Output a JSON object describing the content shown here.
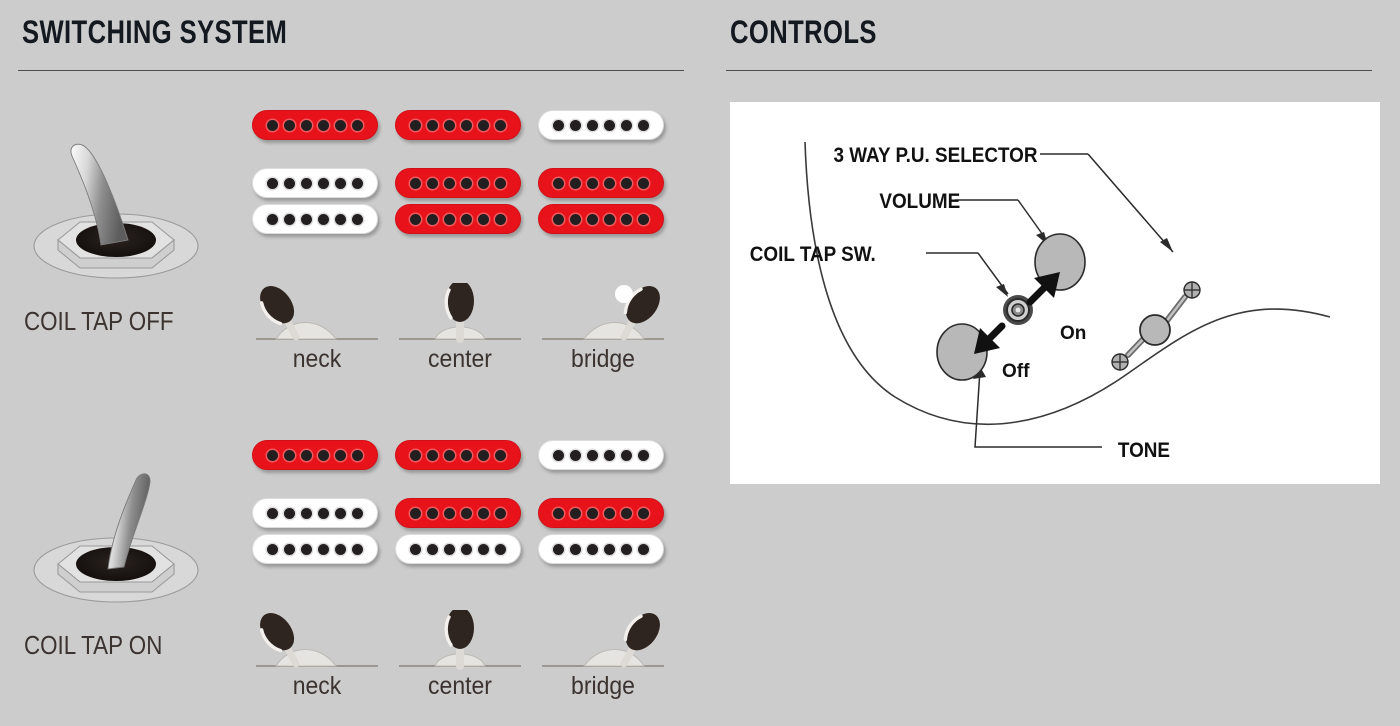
{
  "sections": {
    "switching": {
      "title": "SWITCHING SYSTEM"
    },
    "controls": {
      "title": "CONTROLS"
    }
  },
  "switching_system": {
    "modes": [
      {
        "toggle_label": "COIL TAP OFF",
        "toggle_icon": "mini-toggle-switch-left",
        "toggle_direction": "left",
        "positions": [
          {
            "name": "neck",
            "switch_icon": "lever-switch-neck",
            "pickups": {
              "neck_single": "on",
              "bridge_humbucker_top": "off",
              "bridge_humbucker_bottom": "off"
            }
          },
          {
            "name": "center",
            "switch_icon": "lever-switch-center",
            "pickups": {
              "neck_single": "on",
              "bridge_humbucker_top": "on",
              "bridge_humbucker_bottom": "on"
            }
          },
          {
            "name": "bridge",
            "switch_icon": "lever-switch-bridge",
            "pickups": {
              "neck_single": "off",
              "bridge_humbucker_top": "on",
              "bridge_humbucker_bottom": "on"
            }
          }
        ]
      },
      {
        "toggle_label": "COIL TAP ON",
        "toggle_icon": "mini-toggle-switch-right",
        "toggle_direction": "right",
        "positions": [
          {
            "name": "neck",
            "switch_icon": "lever-switch-neck",
            "pickups": {
              "neck_single": "on",
              "bridge_humbucker_top": "off",
              "bridge_humbucker_bottom": "off"
            }
          },
          {
            "name": "center",
            "switch_icon": "lever-switch-center",
            "pickups": {
              "neck_single": "on",
              "bridge_humbucker_top": "on",
              "bridge_humbucker_bottom": "off"
            }
          },
          {
            "name": "bridge",
            "switch_icon": "lever-switch-bridge",
            "pickups": {
              "neck_single": "off",
              "bridge_humbucker_top": "on",
              "bridge_humbucker_bottom": "off"
            }
          }
        ]
      }
    ],
    "pole_count": 6
  },
  "controls_diagram": {
    "labels": {
      "selector": "3 WAY P.U. SELECTOR",
      "volume": "VOLUME",
      "coil_tap": "COIL TAP SW.",
      "tone": "TONE",
      "on": "On",
      "off": "Off"
    },
    "parts": [
      {
        "name": "volume-knob",
        "icon": "rotary-knob"
      },
      {
        "name": "tone-knob",
        "icon": "rotary-knob"
      },
      {
        "name": "coil-tap-switch",
        "icon": "mini-toggle-switch-top"
      },
      {
        "name": "pickup-selector",
        "icon": "three-way-lever-switch"
      },
      {
        "name": "guitar-body-outline",
        "icon": "body-contour-line"
      }
    ]
  },
  "colors": {
    "background": "#cccccc",
    "pickup_active": "#e8131a",
    "pickup_inactive": "#ffffff",
    "pole_piece": "#231f20",
    "heading_text": "#14181f",
    "label_text": "#3b3330",
    "panel_background": "#ffffff"
  }
}
